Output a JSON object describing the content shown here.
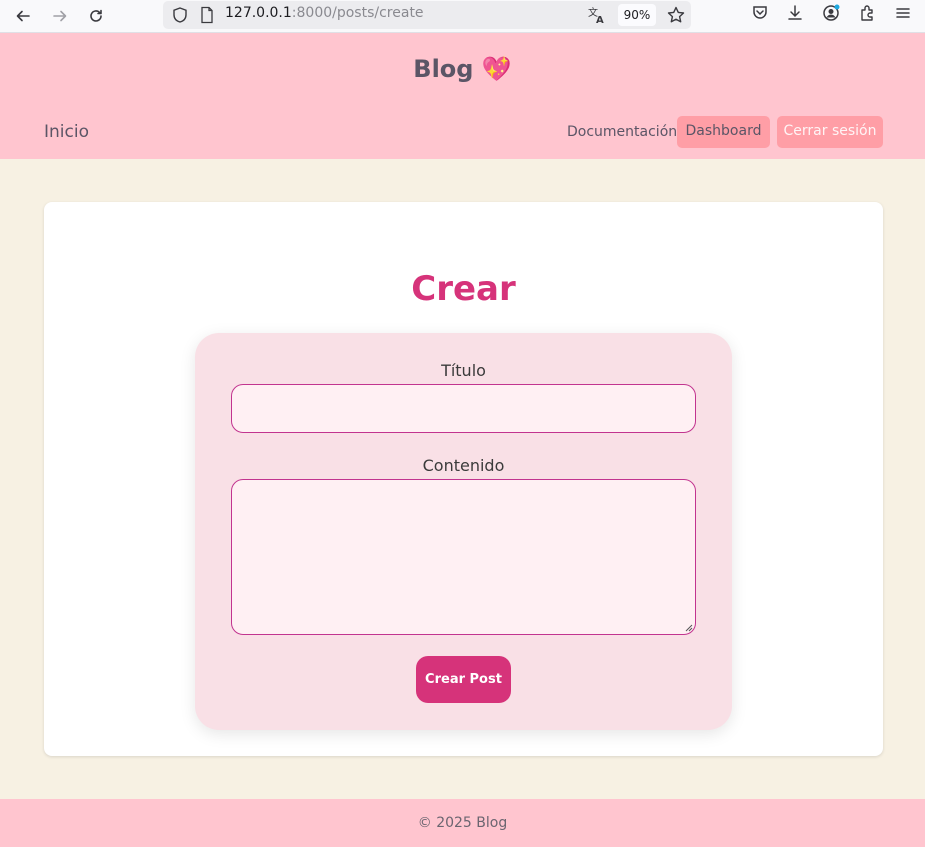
{
  "browser": {
    "url_host": "127.0.0.1",
    "url_path": ":8000/posts/create",
    "zoom": "90%",
    "icons": [
      "back-icon",
      "forward-icon",
      "reload-icon",
      "shield-icon",
      "page-icon",
      "translate-icon",
      "bookmark-star-icon",
      "pocket-icon",
      "download-icon",
      "account-icon",
      "extensions-icon",
      "menu-icon"
    ]
  },
  "header": {
    "brand": "Blog 💖",
    "nav_home": "Inicio",
    "nav_docs": "Documentación",
    "dashboard_label": "Dashboard",
    "logout_label": "Cerrar sesión"
  },
  "main": {
    "title": "Crear",
    "form": {
      "title_label": "Título",
      "title_value": "",
      "content_label": "Contenido",
      "content_value": "",
      "submit_label": "Crear Post"
    }
  },
  "footer": {
    "text": "© 2025 Blog"
  },
  "colors": {
    "header_bg": "#ffc5cf",
    "page_bg": "#f7f1e3",
    "accent": "#d6337a",
    "button_pink": "#ff9ea6",
    "form_bg": "#f9e0e6"
  }
}
